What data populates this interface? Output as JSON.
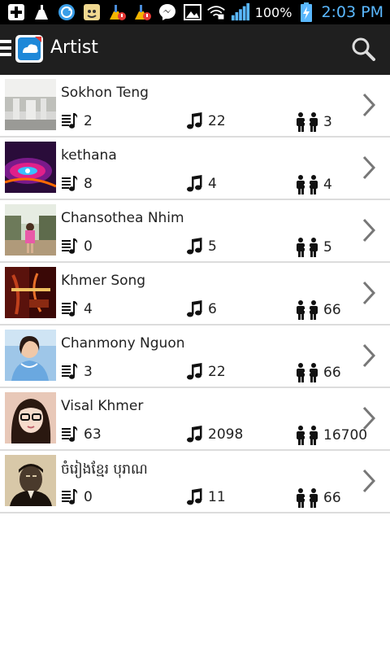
{
  "statusbar": {
    "battery_percent": "100%",
    "time": "2:03 PM",
    "icons": [
      "add-box-icon",
      "clean-master-icon",
      "sync-icon",
      "game-app-icon",
      "cleaner-alert-icon",
      "cleaner-alert-icon",
      "messenger-icon",
      "gallery-icon",
      "wifi-lock-icon",
      "signal-icon",
      "battery-charging-icon"
    ]
  },
  "actionbar": {
    "title": "Artist",
    "icons": [
      "menu-icon",
      "app-logo-icon",
      "search-icon"
    ]
  },
  "artists": [
    {
      "name": "Sokhon Teng",
      "playlists": "2",
      "songs": "22",
      "followers": "3"
    },
    {
      "name": "kethana",
      "playlists": "8",
      "songs": "4",
      "followers": "4"
    },
    {
      "name": "Chansothea Nhim",
      "playlists": "0",
      "songs": "5",
      "followers": "5"
    },
    {
      "name": "Khmer Song",
      "playlists": "4",
      "songs": "6",
      "followers": "66"
    },
    {
      "name": "Chanmony Nguon",
      "playlists": "3",
      "songs": "22",
      "followers": "66"
    },
    {
      "name": "Visal Khmer",
      "playlists": "63",
      "songs": "2098",
      "followers": "16700"
    },
    {
      "name": "ចំរៀងខ្មែរ បុរាណ",
      "playlists": "0",
      "songs": "11",
      "followers": "66"
    }
  ],
  "stat_icons": [
    "playlist-icon",
    "music-note-icon",
    "follow-icon"
  ]
}
